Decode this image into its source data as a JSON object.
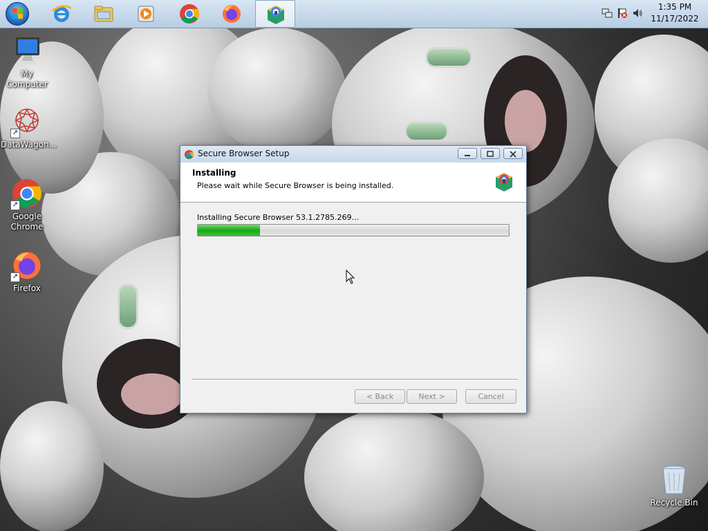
{
  "taskbar": {
    "pinned": [
      {
        "name": "internet-explorer-icon"
      },
      {
        "name": "windows-explorer-icon"
      },
      {
        "name": "media-player-icon"
      },
      {
        "name": "chrome-icon"
      },
      {
        "name": "firefox-icon"
      },
      {
        "name": "secure-browser-icon",
        "active": true
      }
    ],
    "clock": {
      "time": "1:35 PM",
      "date": "11/17/2022"
    }
  },
  "desktop": {
    "icons": [
      {
        "label": "My Computer",
        "icon": "computer-icon"
      },
      {
        "label": "DataWagon...",
        "icon": "datawagon-icon"
      },
      {
        "label": "Google Chrome",
        "icon": "chrome-icon"
      },
      {
        "label": "Firefox",
        "icon": "firefox-icon"
      },
      {
        "label": "Recycle Bin",
        "icon": "recycle-bin-icon"
      }
    ]
  },
  "dialog": {
    "title": "Secure Browser Setup",
    "header_title": "Installing",
    "header_subtitle": "Please wait while Secure Browser is being installed.",
    "status": "Installing Secure Browser 53.1.2785.269...",
    "progress_percent": 20,
    "buttons": {
      "back": "< Back",
      "next": "Next >",
      "cancel": "Cancel"
    }
  },
  "colors": {
    "progress_green": "#1ba51b",
    "taskbar_top": "#d9e6f3",
    "dialog_bg": "#f0f0f0"
  }
}
